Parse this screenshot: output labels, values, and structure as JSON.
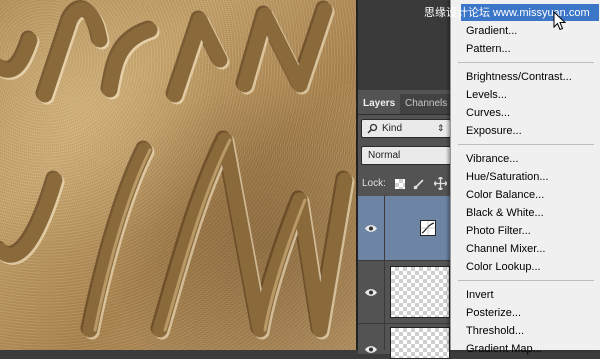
{
  "watermark": "思缘设计论坛 www.missyuan.com",
  "layers_panel": {
    "tabs": [
      "Layers",
      "Channels"
    ],
    "kind_filter": "Kind",
    "blend_mode": "Normal",
    "lock_label": "Lock:"
  },
  "adjustment_menu": {
    "groups": [
      [
        "Gradient...",
        "Pattern..."
      ],
      [
        "Brightness/Contrast...",
        "Levels...",
        "Curves...",
        "Exposure..."
      ],
      [
        "Vibrance...",
        "Hue/Saturation...",
        "Color Balance...",
        "Black & White...",
        "Photo Filter...",
        "Channel Mixer...",
        "Color Lookup..."
      ],
      [
        "Invert",
        "Posterize...",
        "Threshold...",
        "Gradient Map..."
      ]
    ]
  },
  "icons": {
    "search": "search-icon",
    "eye": "eye-icon",
    "curves_adjustment": "curves-adjustment-icon",
    "cursor": "mouse-pointer-icon"
  },
  "colors": {
    "menu_highlight": "#3b76c9",
    "layer_selected": "#6d84a4",
    "sand": "#b8935a"
  }
}
